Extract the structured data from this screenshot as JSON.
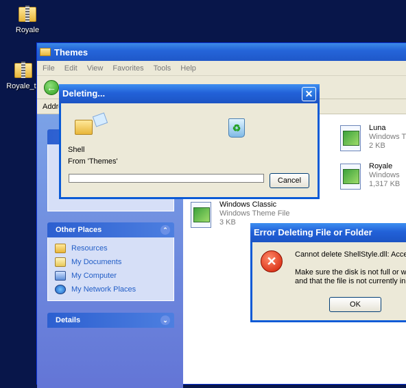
{
  "desktop": {
    "icons": [
      {
        "label": "Royale"
      },
      {
        "label": "Royale_th"
      }
    ]
  },
  "explorer": {
    "title": "Themes",
    "menu": [
      "File",
      "Edit",
      "View",
      "Favorites",
      "Tools",
      "Help"
    ],
    "address_label": "Addre",
    "other_places": {
      "title": "Other Places",
      "items": [
        "Resources",
        "My Documents",
        "My Computer",
        "My Network Places"
      ]
    },
    "details": {
      "title": "Details"
    },
    "files": [
      {
        "name": "Luna",
        "type": "Windows T",
        "size": "2 KB"
      },
      {
        "name": "Royale",
        "type": "Windows",
        "size": "1,317 KB"
      },
      {
        "name": "Windows Classic",
        "type": "Windows Theme File",
        "size": "3 KB"
      }
    ]
  },
  "deleting_dialog": {
    "title": "Deleting...",
    "item": "Shell",
    "from": "From 'Themes'",
    "progress": 0,
    "cancel_label": "Cancel"
  },
  "error_dialog": {
    "title": "Error Deleting File or Folder",
    "line1": "Cannot delete ShellStyle.dll: Acces",
    "line2": "Make sure the disk is not full or wr",
    "line3": "and that the file is not currently in",
    "ok_label": "OK"
  },
  "colors": {
    "desktop": "#08164a",
    "title_blue": "#2565d9",
    "task_pane": "#6375d6",
    "link": "#215dc6"
  }
}
